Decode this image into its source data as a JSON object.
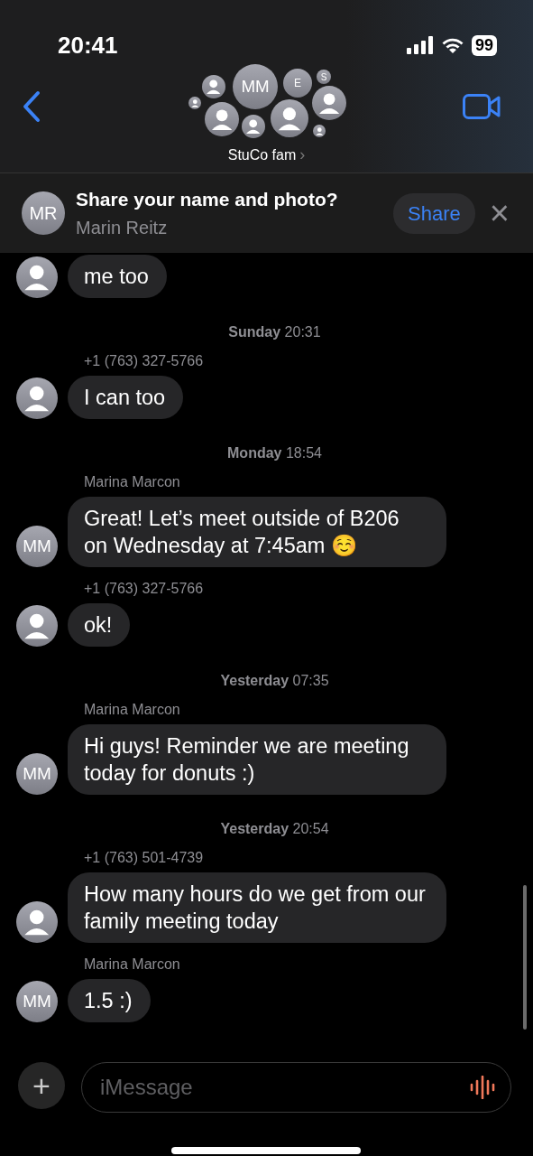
{
  "status_bar": {
    "time": "20:41",
    "battery": "99"
  },
  "header": {
    "title": "StuCo fam",
    "chevron": "›",
    "avatars": [
      {
        "kind": "person"
      },
      {
        "kind": "initials",
        "initials": "MM"
      },
      {
        "kind": "initials",
        "initials": "E"
      },
      {
        "kind": "initials",
        "initials": "S"
      },
      {
        "kind": "person"
      },
      {
        "kind": "person"
      },
      {
        "kind": "person"
      },
      {
        "kind": "person"
      },
      {
        "kind": "person"
      },
      {
        "kind": "person"
      }
    ]
  },
  "share_banner": {
    "initials": "MR",
    "title": "Share your name and photo?",
    "name": "Marin Reitz",
    "button": "Share",
    "close": "×"
  },
  "messages": [
    {
      "kind": "message",
      "avatar": {
        "kind": "person"
      },
      "text": "me too"
    },
    {
      "kind": "timestamp",
      "text": "**Sunday** 20:31"
    },
    {
      "kind": "sender",
      "text": "+1 (763) 327-5766"
    },
    {
      "kind": "message",
      "avatar": {
        "kind": "person"
      },
      "text": "I can too"
    },
    {
      "kind": "timestamp",
      "text": "**Monday** 18:54"
    },
    {
      "kind": "sender",
      "text": "Marina Marcon"
    },
    {
      "kind": "message",
      "avatar": {
        "kind": "initials",
        "initials": "MM"
      },
      "text": "Great! Let’s meet outside of B206 on Wednesday at 7:45am ☺️"
    },
    {
      "kind": "sender",
      "text": "+1 (763) 327-5766"
    },
    {
      "kind": "message",
      "avatar": {
        "kind": "person"
      },
      "text": "ok!"
    },
    {
      "kind": "timestamp",
      "text": "**Yesterday** 07:35"
    },
    {
      "kind": "sender",
      "text": "Marina Marcon"
    },
    {
      "kind": "message",
      "avatar": {
        "kind": "initials",
        "initials": "MM"
      },
      "text": "Hi guys! Reminder we are meeting today for donuts :)"
    },
    {
      "kind": "timestamp",
      "text": "**Yesterday** 20:54"
    },
    {
      "kind": "sender",
      "text": "+1 (763) 501-4739"
    },
    {
      "kind": "message",
      "avatar": {
        "kind": "person"
      },
      "text": "How many hours do we get from our family meeting today"
    },
    {
      "kind": "sender",
      "text": "Marina Marcon"
    },
    {
      "kind": "message",
      "avatar": {
        "kind": "initials",
        "initials": "MM"
      },
      "text": "1.5 :)"
    }
  ],
  "composer": {
    "add": "+",
    "placeholder": "iMessage"
  }
}
